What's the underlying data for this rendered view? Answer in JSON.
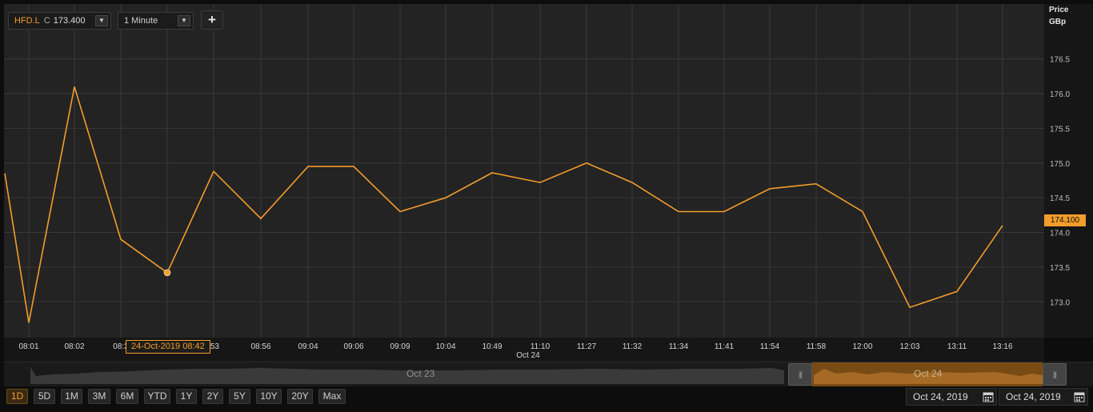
{
  "toolbar": {
    "symbol": "HFD.L",
    "close_marker": "C",
    "last_price": "173.400",
    "interval": "1 Minute",
    "add_button": "+"
  },
  "axis": {
    "title_line1": "Price",
    "title_line2": "GBp",
    "last_value_badge": "174.100",
    "date_caption": "Oct 24"
  },
  "tooltip": {
    "text": "24-Oct-2019 08:42"
  },
  "navigator": {
    "label_left": "Oct 23",
    "label_right": "Oct 24",
    "handle_glyph": "|||"
  },
  "range_buttons": [
    "1D",
    "5D",
    "1M",
    "3M",
    "6M",
    "YTD",
    "1Y",
    "2Y",
    "5Y",
    "10Y",
    "20Y",
    "Max"
  ],
  "active_range": "1D",
  "dates": {
    "from": "Oct 24, 2019",
    "to": "Oct 24, 2019"
  },
  "colors": {
    "line": "#f39c2a",
    "background": "#232323",
    "grid": "#383838",
    "accent": "#f39c2a"
  },
  "chart_data": {
    "type": "line",
    "title": "",
    "xlabel": "",
    "ylabel": "Price GBp",
    "ylim": [
      172.6,
      176.75
    ],
    "yticks": [
      "173.0",
      "173.5",
      "174.0",
      "174.5",
      "175.0",
      "175.5",
      "176.0",
      "176.5"
    ],
    "x_labels": [
      "08:01",
      "08:02",
      "08:3",
      "08:42",
      "08:53",
      "08:56",
      "09:04",
      "09:06",
      "09:09",
      "10:04",
      "10:49",
      "11:10",
      "11:27",
      "11:32",
      "11:34",
      "11:41",
      "11:54",
      "11:58",
      "12:00",
      "12:03",
      "13:11",
      "13:16"
    ],
    "x_tick_labels_shown": [
      "08:01",
      "08:02",
      "08:3",
      ":53",
      "08:56",
      "09:04",
      "09:06",
      "09:09",
      "10:04",
      "10:49",
      "11:10",
      "11:27",
      "11:32",
      "11:34",
      "11:41",
      "11:54",
      "11:58",
      "12:00",
      "12:03",
      "13:11",
      "13:16"
    ],
    "series": [
      {
        "values": [
          174.85,
          172.7,
          176.1,
          173.9,
          173.42,
          174.88,
          174.2,
          174.95,
          174.95,
          174.3,
          174.5,
          174.86,
          174.72,
          175.0,
          174.72,
          174.3,
          174.3,
          174.63,
          174.7,
          174.3,
          172.92,
          173.15,
          174.1
        ]
      }
    ],
    "highlight": {
      "label": "24-Oct-2019 08:42",
      "value": 173.42
    },
    "grid": true
  }
}
